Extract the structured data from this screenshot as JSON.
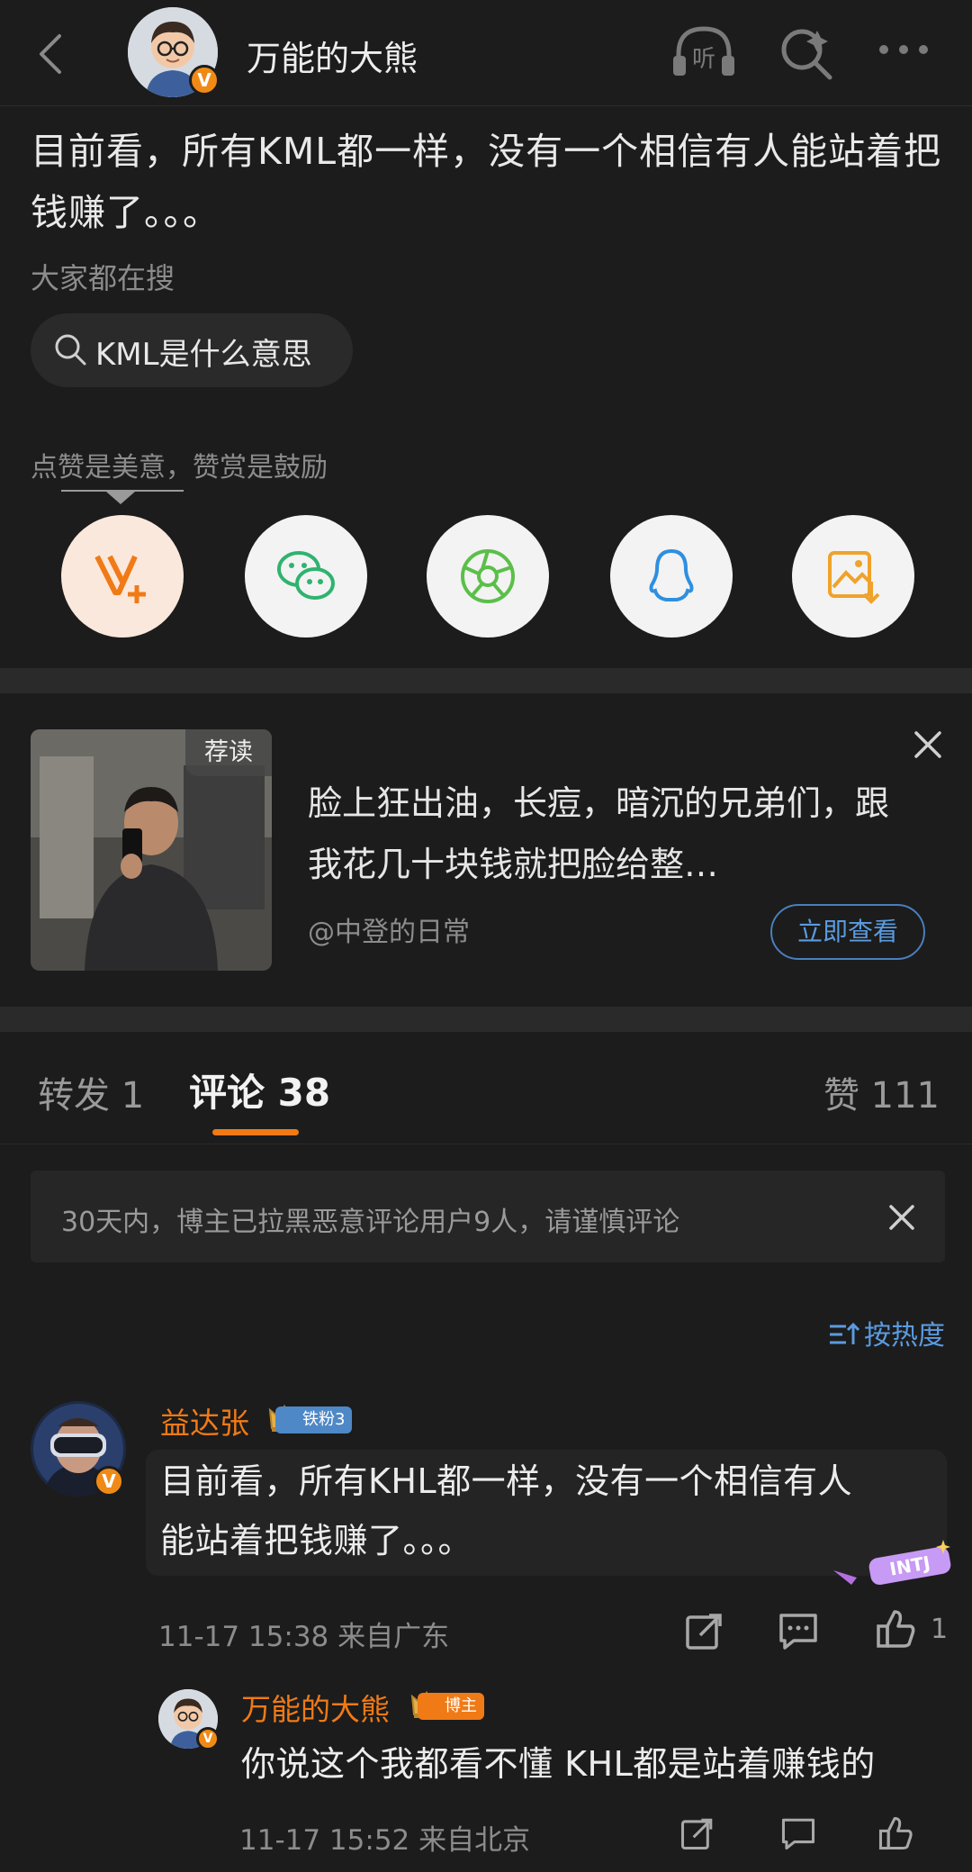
{
  "topbar": {
    "author_name": "万能的大熊",
    "listen_label": "听",
    "verified_mark": "V"
  },
  "post": {
    "text": "目前看，所有KML都一样，没有一个相信有人能站着把钱赚了。。。"
  },
  "hot_search": {
    "label": "大家都在搜",
    "query": "KML是什么意思"
  },
  "reward": {
    "text": "点赞是美意，赞赏是鼓励",
    "share_targets": [
      "weibo-vplus-icon",
      "wechat-icon",
      "moments-icon",
      "qq-icon",
      "save-image-icon"
    ]
  },
  "recommended": {
    "tag": "荐读",
    "title": "脸上狂出油，长痘，暗沉的兄弟们，跟我花几十块钱就把脸给整…",
    "author": "@中登的日常",
    "button": "立即查看"
  },
  "tabs": {
    "repost": "转发 1",
    "comment": "评论 38",
    "like": "赞 111"
  },
  "notice": {
    "text": "30天内，博主已拉黑恶意评论用户9人，请谨慎评论"
  },
  "sort": {
    "label": "按热度"
  },
  "comments": [
    {
      "name": "益达张",
      "badge": "铁粉3",
      "text_line1": "目前看，所有KHL都一样，没有一个相信有人",
      "text_line2": "能站着把钱赚了。。。",
      "time": "11-17 15:38",
      "location": "来自广东",
      "likes": "1",
      "sticker": "INTJ"
    }
  ],
  "reply": {
    "name": "万能的大熊",
    "badge": "博主",
    "text": "你说这个我都看不懂 KHL都是站着赚钱的",
    "time": "11-17 15:52",
    "location": "来自北京"
  },
  "colors": {
    "background": "#1c1c1c",
    "accent_orange": "#f07a16",
    "link_blue": "#5a9be0"
  }
}
